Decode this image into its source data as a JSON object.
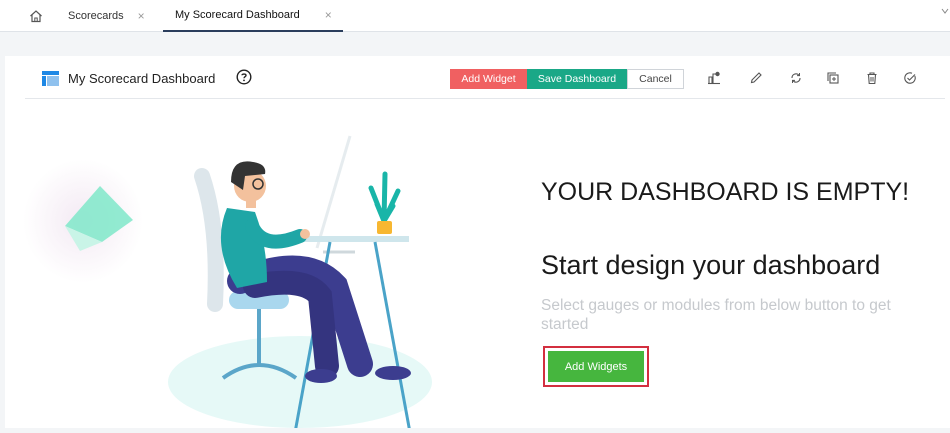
{
  "tabs": {
    "home_icon": "home-icon",
    "items": [
      {
        "label": "Scorecards",
        "close": "×"
      },
      {
        "label": "My Scorecard Dashboard",
        "close": "×"
      }
    ]
  },
  "header": {
    "title": "My Scorecard Dashboard",
    "help_icon": "help-circle-icon",
    "add_widget": "Add Widget",
    "save_dashboard": "Save Dashboard",
    "cancel": "Cancel",
    "toolbar_icons": [
      "add-chart-icon",
      "edit-icon",
      "refresh-icon",
      "duplicate-icon",
      "delete-icon",
      "settings-check-icon"
    ]
  },
  "empty_state": {
    "headline": "YOUR DASHBOARD IS EMPTY!",
    "subhead": "Start design your dashboard",
    "hint": "Select gauges or modules from below button to get started",
    "cta": "Add Widgets"
  },
  "colors": {
    "add_widget_bg": "#f06061",
    "save_bg": "#1aa887",
    "cta_bg": "#46b63e",
    "cta_highlight": "#d32f3f",
    "active_tab_underline": "#2a3d5c"
  }
}
